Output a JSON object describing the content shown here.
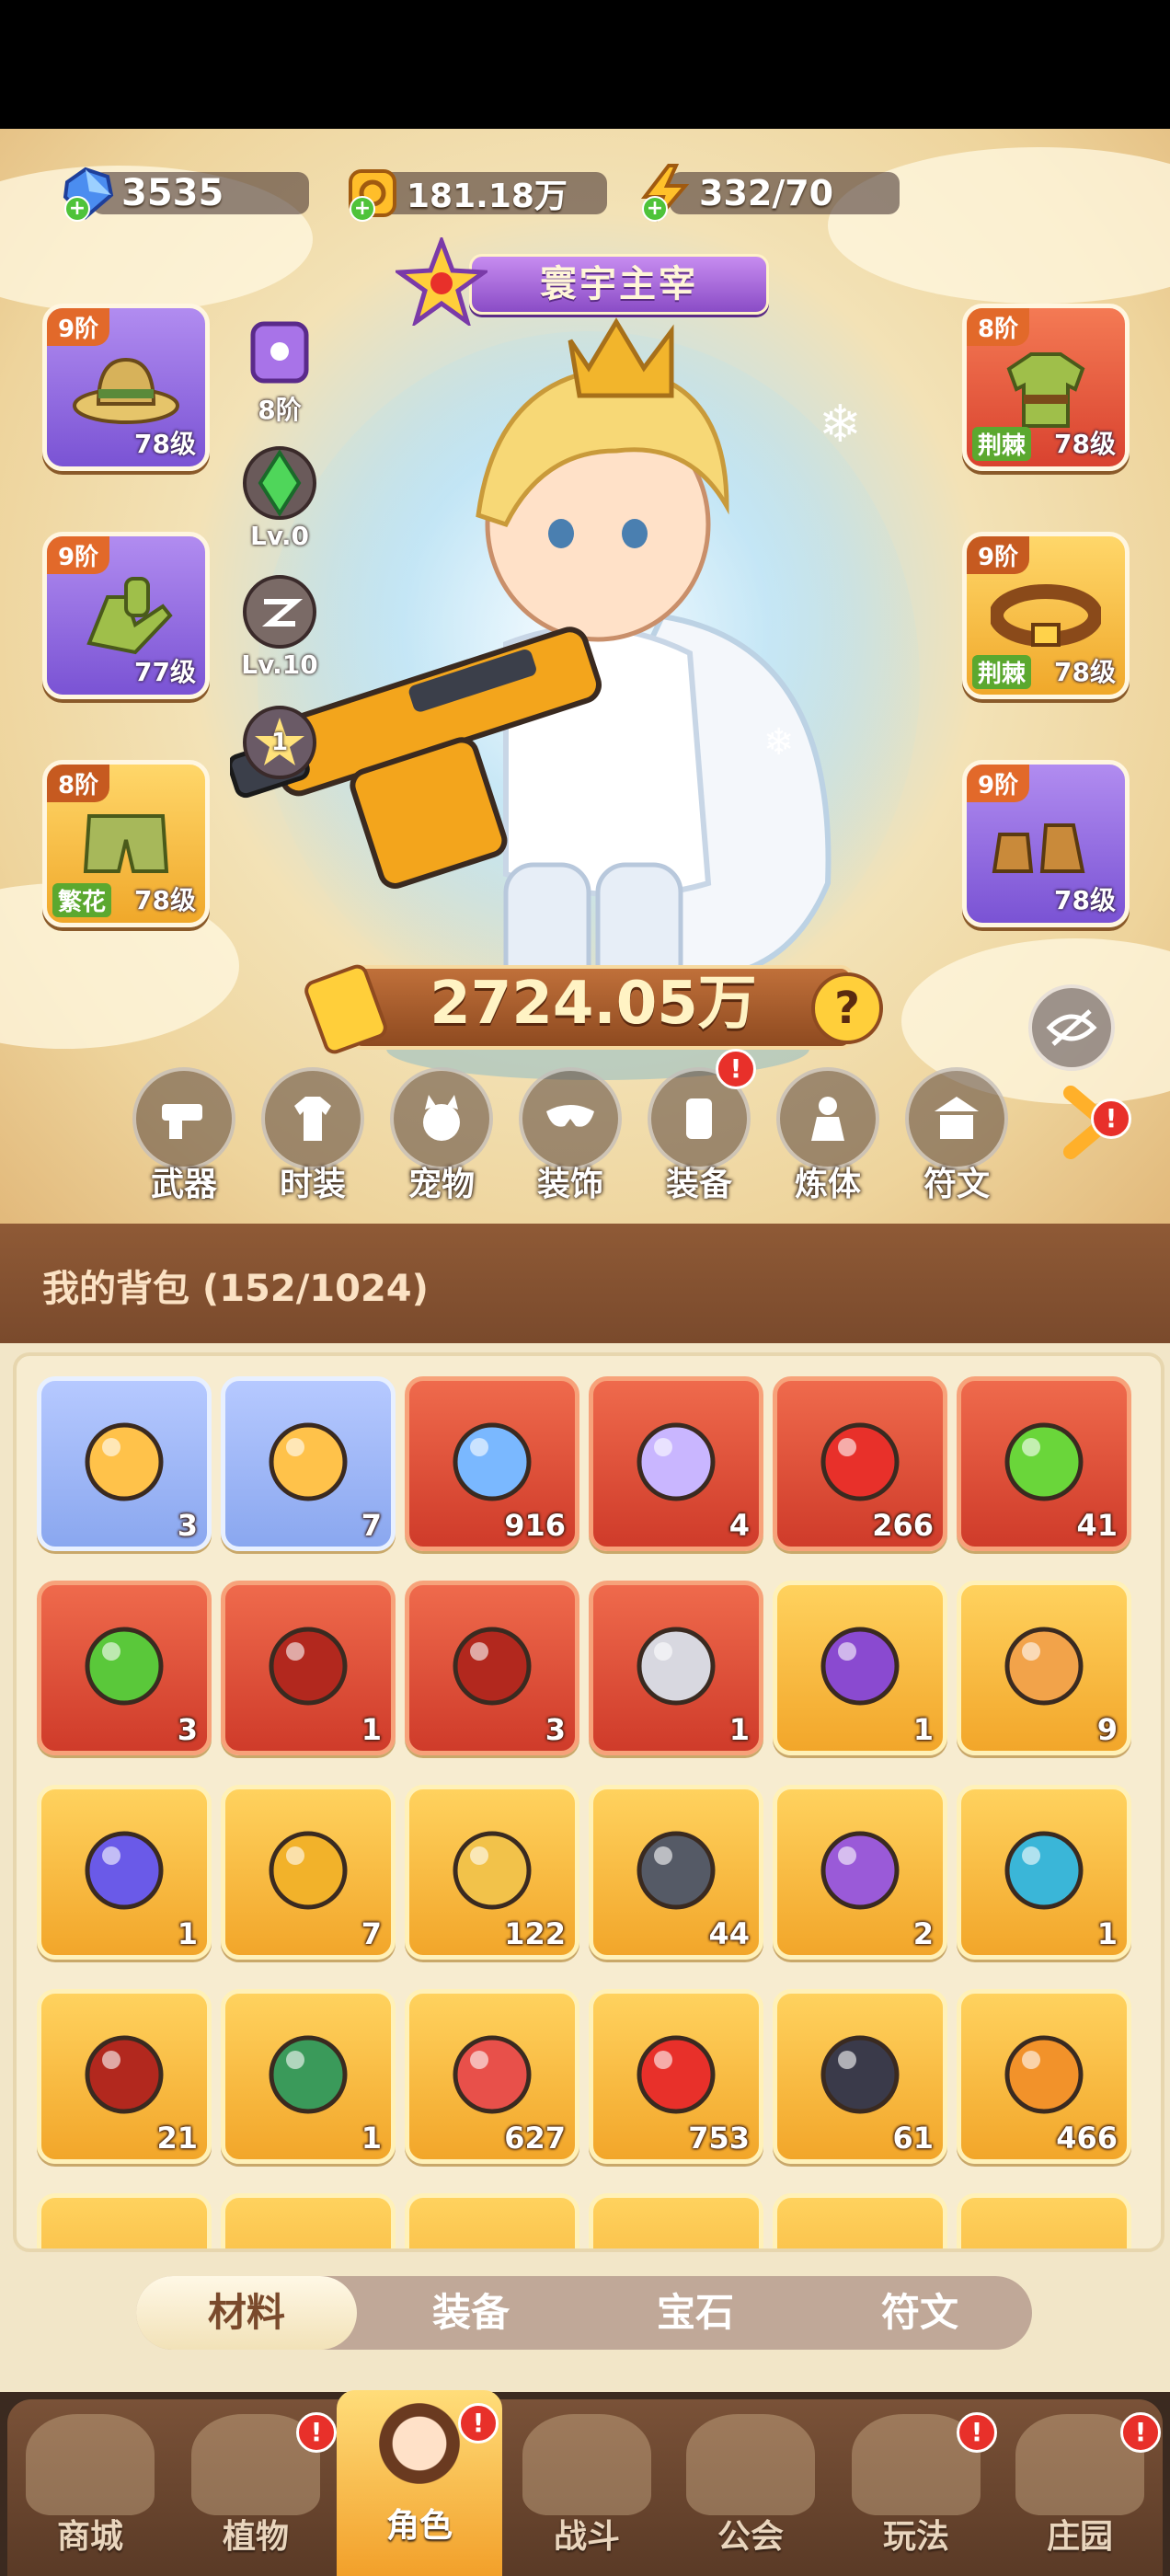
{
  "currency": [
    {
      "icon": "diamond-icon",
      "value": "3535"
    },
    {
      "icon": "gold-coin-icon",
      "value": "181.18万"
    },
    {
      "icon": "energy-bolt-icon",
      "value": "332/70"
    }
  ],
  "title_badge": "寰宇主宰",
  "equipment_left": [
    {
      "tier": "9阶",
      "level": "78级",
      "tag": "",
      "icon": "hat-icon",
      "color": "purple"
    },
    {
      "tier": "9阶",
      "level": "77级",
      "tag": "",
      "icon": "gloves-icon",
      "color": "purple"
    },
    {
      "tier": "8阶",
      "level": "78级",
      "tag": "繁花",
      "icon": "pants-icon",
      "color": "gold"
    }
  ],
  "equipment_right": [
    {
      "tier": "8阶",
      "level": "78级",
      "tag": "荆棘",
      "icon": "armor-icon",
      "color": "red"
    },
    {
      "tier": "9阶",
      "level": "78级",
      "tag": "荆棘",
      "icon": "belt-icon",
      "color": "gold"
    },
    {
      "tier": "9阶",
      "level": "78级",
      "tag": "",
      "icon": "boots-icon",
      "color": "purple"
    }
  ],
  "medals": [
    {
      "label": "8阶",
      "icon": "pet-bag-icon"
    },
    {
      "label": "Lv.0",
      "icon": "green-gem-icon"
    },
    {
      "label": "Lv.10",
      "icon": "rune-icon"
    },
    {
      "label": "1",
      "icon": "star-orb-icon"
    }
  ],
  "power": "2724.05万",
  "power_help": "?",
  "functions": [
    {
      "label": "武器",
      "icon": "weapon-icon",
      "alert": false
    },
    {
      "label": "时装",
      "icon": "outfit-icon",
      "alert": false
    },
    {
      "label": "宠物",
      "icon": "pet-icon",
      "alert": false
    },
    {
      "label": "装饰",
      "icon": "mask-icon",
      "alert": false
    },
    {
      "label": "装备",
      "icon": "equipment-icon",
      "alert": true
    },
    {
      "label": "炼体",
      "icon": "body-refine-icon",
      "alert": false
    },
    {
      "label": "符文",
      "icon": "rune-shrine-icon",
      "alert": false
    }
  ],
  "bag_title": "我的背包 (152/1024)",
  "bag_items": [
    {
      "count": "3",
      "icon": "vial-icon",
      "color": "blue"
    },
    {
      "count": "7",
      "icon": "vial-puzzle-icon",
      "color": "blue"
    },
    {
      "count": "916",
      "icon": "blue-star-crystal-icon",
      "color": "red"
    },
    {
      "count": "4",
      "icon": "moon-crystal-icon",
      "color": "red"
    },
    {
      "count": "266",
      "icon": "red-potion-icon",
      "color": "red"
    },
    {
      "count": "41",
      "icon": "green-capsule-icon",
      "color": "red"
    },
    {
      "count": "3",
      "icon": "green-pill-icon",
      "color": "red"
    },
    {
      "count": "1",
      "icon": "red-book-icon",
      "color": "red"
    },
    {
      "count": "3",
      "icon": "red-card-icon",
      "color": "red"
    },
    {
      "count": "1",
      "icon": "scissors-icon",
      "color": "red"
    },
    {
      "count": "1",
      "icon": "skull-scroll-icon",
      "color": "gold"
    },
    {
      "count": "9",
      "icon": "ankh-icon",
      "color": "gold"
    },
    {
      "count": "1",
      "icon": "crystal-ball-icon",
      "color": "gold"
    },
    {
      "count": "7",
      "icon": "ruby-key-icon",
      "color": "gold"
    },
    {
      "count": "122",
      "icon": "gold-key-icon",
      "color": "gold"
    },
    {
      "count": "44",
      "icon": "fire-prism-icon",
      "color": "gold"
    },
    {
      "count": "2",
      "icon": "star-amulet-icon",
      "color": "gold"
    },
    {
      "count": "1",
      "icon": "mushroom-icon",
      "color": "gold"
    },
    {
      "count": "21",
      "icon": "gift-book-icon",
      "color": "gold"
    },
    {
      "count": "1",
      "icon": "green-cube-icon",
      "color": "gold"
    },
    {
      "count": "627",
      "icon": "fruit-basket-icon",
      "color": "gold"
    },
    {
      "count": "753",
      "icon": "flower-basket-icon",
      "color": "gold"
    },
    {
      "count": "61",
      "icon": "dark-rune-stone-icon",
      "color": "gold"
    },
    {
      "count": "466",
      "icon": "orange-potion-icon",
      "color": "gold"
    }
  ],
  "bag_tabs": [
    "材料",
    "装备",
    "宝石",
    "符文"
  ],
  "bag_tab_active": 0,
  "nav": [
    {
      "label": "商城",
      "icon": "shop-icon",
      "alert": false
    },
    {
      "label": "植物",
      "icon": "plant-icon",
      "alert": true
    },
    {
      "label": "角色",
      "icon": "character-icon",
      "alert": true
    },
    {
      "label": "战斗",
      "icon": "battle-icon",
      "alert": false
    },
    {
      "label": "公会",
      "icon": "guild-icon",
      "alert": false
    },
    {
      "label": "玩法",
      "icon": "gameplay-icon",
      "alert": true
    },
    {
      "label": "庄园",
      "icon": "manor-icon",
      "alert": true
    }
  ],
  "nav_active": 2
}
